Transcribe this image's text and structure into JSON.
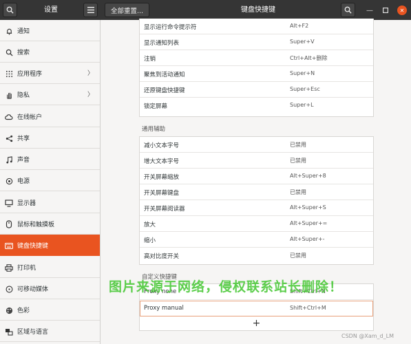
{
  "header": {
    "left_title": "设置",
    "reset_button": "全部重置...",
    "title": "键盘快捷键"
  },
  "sidebar": {
    "items": [
      {
        "label": "通知",
        "icon": "bell-icon"
      },
      {
        "label": "搜索",
        "icon": "search-icon"
      },
      {
        "label": "应用程序",
        "icon": "grid-icon",
        "chevron": "〉"
      },
      {
        "label": "隐私",
        "icon": "hand-icon",
        "chevron": "〉"
      },
      {
        "label": "在线帐户",
        "icon": "cloud-icon"
      },
      {
        "label": "共享",
        "icon": "share-icon"
      },
      {
        "label": "声音",
        "icon": "music-note-icon"
      },
      {
        "label": "电源",
        "icon": "power-icon"
      },
      {
        "label": "显示器",
        "icon": "display-icon"
      },
      {
        "label": "鼠标和触摸板",
        "icon": "mouse-icon"
      },
      {
        "label": "键盘快捷键",
        "icon": "keyboard-icon",
        "selected": true
      },
      {
        "label": "打印机",
        "icon": "printer-icon"
      },
      {
        "label": "可移动媒体",
        "icon": "media-icon"
      },
      {
        "label": "色彩",
        "icon": "palette-icon"
      },
      {
        "label": "区域与语言",
        "icon": "globe-icon"
      }
    ]
  },
  "system_rows": [
    {
      "name": "显示运行命令提示符",
      "key": "Alt+F2"
    },
    {
      "name": "显示通知列表",
      "key": "Super+V"
    },
    {
      "name": "注销",
      "key": "Ctrl+Alt+删除"
    },
    {
      "name": "聚焦到活动通知",
      "key": "Super+N"
    },
    {
      "name": "还原键盘快捷键",
      "key": "Super+Esc"
    },
    {
      "name": "锁定屏幕",
      "key": "Super+L"
    }
  ],
  "accessibility": {
    "title": "通用辅助",
    "rows": [
      {
        "name": "减小文本字号",
        "key": "已禁用"
      },
      {
        "name": "增大文本字号",
        "key": "已禁用"
      },
      {
        "name": "开关屏幕缩放",
        "key": "Alt+Super+8"
      },
      {
        "name": "开关屏幕键盘",
        "key": "已禁用"
      },
      {
        "name": "开关屏幕阅读器",
        "key": "Alt+Super+S"
      },
      {
        "name": "放大",
        "key": "Alt+Super+="
      },
      {
        "name": "缩小",
        "key": "Alt+Super+-"
      },
      {
        "name": "高对比度开关",
        "key": "已禁用"
      }
    ]
  },
  "custom": {
    "title": "自定义快捷键",
    "rows": [
      {
        "name": "Proxy none",
        "key": "Shift+Ctrl+N"
      },
      {
        "name": "Proxy manual",
        "key": "Shift+Ctrl+M"
      }
    ],
    "add": "+"
  },
  "watermark": "图片来源于网络，侵权联系站长删除！",
  "credit": "CSDN @Xam_d_LM",
  "colors": {
    "accent": "#e95420",
    "headerbar": "#353535",
    "watermark": "#4cc93a"
  }
}
